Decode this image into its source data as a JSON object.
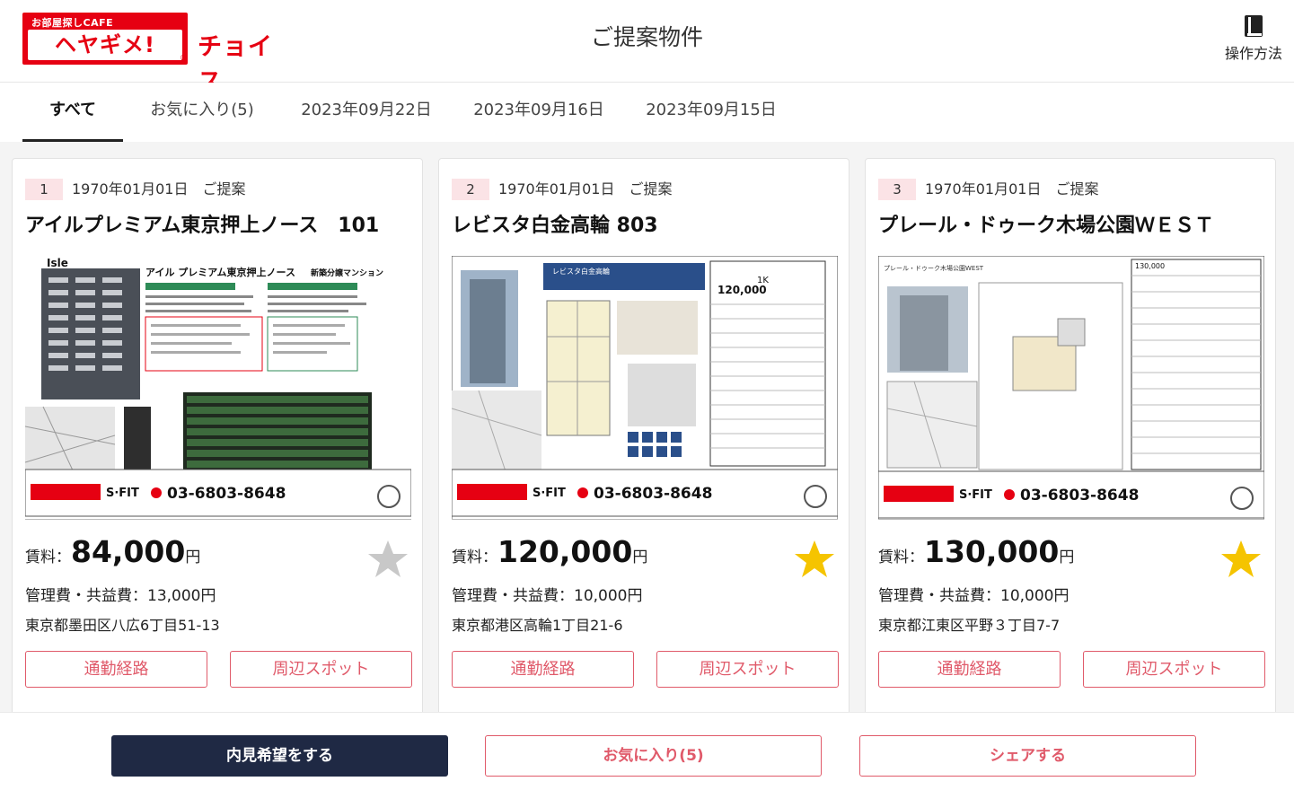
{
  "header": {
    "logo_small": "お部屋探しCAFE",
    "logo_main": "ヘヤギメ!",
    "logo_reg": "®",
    "logo_choice": "チョイス",
    "title": "ご提案物件",
    "help_icon": "book-icon",
    "help_label": "操作方法"
  },
  "tabs": [
    {
      "label": "すべて",
      "active": true
    },
    {
      "label": "お気に入り(5)",
      "active": false
    },
    {
      "label": "2023年09月22日",
      "active": false
    },
    {
      "label": "2023年09月16日",
      "active": false
    },
    {
      "label": "2023年09月15日",
      "active": false
    }
  ],
  "cards": [
    {
      "num": "1",
      "date": "1970年01月01日　ご提案",
      "name": "アイルプレミアム東京押上ノース　101",
      "flyer": {
        "title": "アイル プレミアム東京押上ノース",
        "tag": "新築分譲マンション",
        "brand": "Isle",
        "phone": "03-6803-8648",
        "company": "S·FIT"
      },
      "price_label": "賃料：",
      "price": "84,000",
      "price_unit": "円",
      "favorite": false,
      "fee": "管理費・共益費：13,000円",
      "address": "東京都墨田区八広6丁目51-13",
      "btn_route": "通勤経路",
      "btn_spot": "周辺スポット"
    },
    {
      "num": "2",
      "date": "1970年01月01日　ご提案",
      "name": "レビスタ白金高輪 803",
      "flyer": {
        "title": "レビスタ白金高輪",
        "rent": "120,000",
        "layout": "1K",
        "phone": "03-6803-8648",
        "company": "S·FIT"
      },
      "price_label": "賃料：",
      "price": "120,000",
      "price_unit": "円",
      "favorite": true,
      "fee": "管理費・共益費：10,000円",
      "address": "東京都港区高輪1丁目21-6",
      "btn_route": "通勤経路",
      "btn_spot": "周辺スポット"
    },
    {
      "num": "3",
      "date": "1970年01月01日　ご提案",
      "name": "プレール・ドゥーク木場公園ＷＥＳＴ",
      "flyer": {
        "title": "プレール・ドゥーク木場公園WEST",
        "rent": "130,000",
        "phone": "03-6803-8648",
        "company": "S·FIT"
      },
      "price_label": "賃料：",
      "price": "130,000",
      "price_unit": "円",
      "favorite": true,
      "fee": "管理費・共益費：10,000円",
      "address": "東京都江東区平野３丁目7-7",
      "btn_route": "通勤経路",
      "btn_spot": "周辺スポット"
    }
  ],
  "bottom": {
    "visit_label": "内見希望をする",
    "favorites_label": "お気に入り(5)",
    "share_label": "シェアする"
  },
  "colors": {
    "brand_red": "#e60012",
    "accent_pink": "#e05a6a",
    "navy": "#1f2944",
    "star_on": "#f5c400",
    "star_off": "#c8c8c8"
  }
}
